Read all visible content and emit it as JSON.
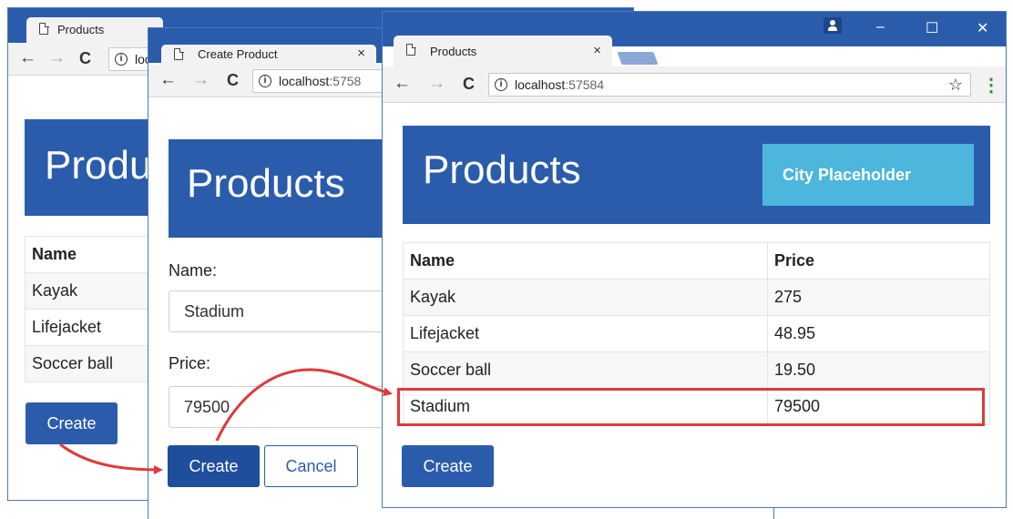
{
  "colors": {
    "accent": "#2b5cab",
    "city_badge": "#4cb6dc",
    "highlight": "#e03a3a"
  },
  "win1": {
    "tab_title": "Products",
    "url_prefix": "loc",
    "heading": "Products",
    "table": {
      "headers": [
        "Name"
      ],
      "rows": [
        [
          "Kayak"
        ],
        [
          "Lifejacket"
        ],
        [
          "Soccer ball"
        ]
      ]
    },
    "create_label": "Create"
  },
  "win2": {
    "tab_title": "Create Product",
    "tab_close": "×",
    "url_host": "localhost",
    "url_port": ":5758",
    "heading": "Products",
    "name_label": "Name:",
    "name_value": "Stadium",
    "price_label": "Price:",
    "price_value": "79500",
    "create_label": "Create",
    "cancel_label": "Cancel"
  },
  "win3": {
    "tab_title": "Products",
    "tab_close": "×",
    "url_host": "localhost",
    "url_port": ":57584",
    "heading": "Products",
    "city_badge": "City Placeholder",
    "table": {
      "headers": [
        "Name",
        "Price"
      ],
      "rows": [
        [
          "Kayak",
          "275"
        ],
        [
          "Lifejacket",
          "48.95"
        ],
        [
          "Soccer ball",
          "19.50"
        ],
        [
          "Stadium",
          "79500"
        ]
      ]
    },
    "create_label": "Create"
  },
  "toolbar": {
    "back": "←",
    "forward": "→",
    "reload": "C",
    "info": "i",
    "star": "☆",
    "menu": "⋮"
  },
  "window_controls": {
    "minimize": "–",
    "maximize": "☐",
    "close": "✕"
  }
}
